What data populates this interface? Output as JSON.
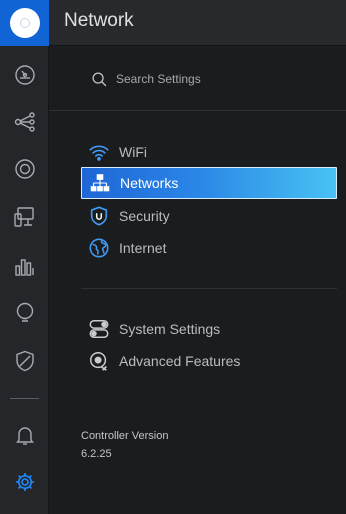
{
  "header": {
    "title": "Network"
  },
  "search": {
    "placeholder": "Search Settings",
    "icon": "search-icon"
  },
  "rail": {
    "items": [
      {
        "name": "dashboard",
        "icon": "speedometer-icon"
      },
      {
        "name": "topology",
        "icon": "topology-icon"
      },
      {
        "name": "devices",
        "icon": "device-ring-icon"
      },
      {
        "name": "clients",
        "icon": "clients-icon"
      },
      {
        "name": "statistics",
        "icon": "bar-chart-icon"
      },
      {
        "name": "insights",
        "icon": "bulb-icon"
      },
      {
        "name": "threat-management",
        "icon": "shield-icon"
      },
      {
        "name": "alerts",
        "icon": "bell-icon"
      },
      {
        "name": "settings",
        "icon": "gear-icon",
        "active": true
      }
    ]
  },
  "menu": {
    "group1": [
      {
        "label": "WiFi",
        "icon": "wifi-icon",
        "active": false
      },
      {
        "label": "Networks",
        "icon": "network-topology-icon",
        "active": true
      },
      {
        "label": "Security",
        "icon": "security-shield-icon",
        "active": false
      },
      {
        "label": "Internet",
        "icon": "globe-icon",
        "active": false
      }
    ],
    "group2": [
      {
        "label": "System Settings",
        "icon": "toggles-icon",
        "active": false
      },
      {
        "label": "Advanced Features",
        "icon": "advanced-gear-icon",
        "active": false
      }
    ]
  },
  "controller": {
    "label": "Controller Version",
    "version": "6.2.25"
  },
  "colors": {
    "accent": "#1164d4",
    "active_gradient_start": "#1f66d6",
    "active_gradient_end": "#48c2f4",
    "icon_blue": "#3f9bf2",
    "rail_icon": "#a7aab0"
  }
}
